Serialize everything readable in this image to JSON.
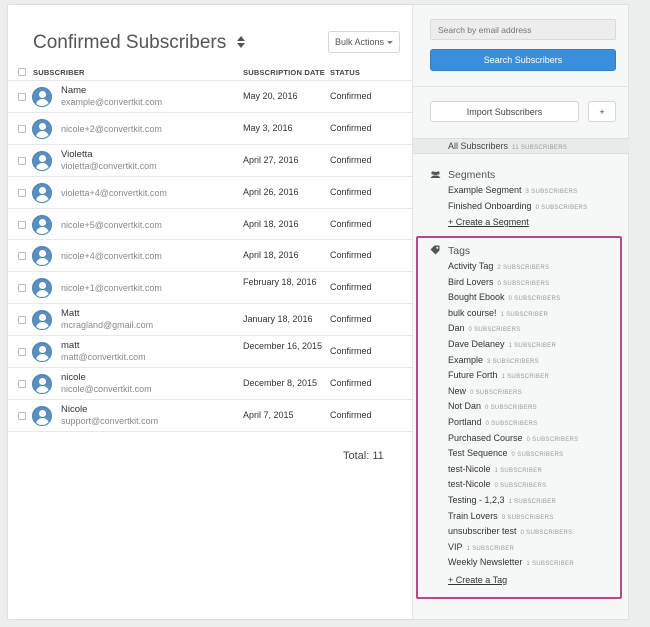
{
  "main": {
    "title": "Confirmed Subscribers",
    "bulk_actions_label": "Bulk Actions",
    "columns": {
      "subscriber": "SUBSCRIBER",
      "date": "SUBSCRIPTION DATE",
      "status": "STATUS"
    },
    "rows": [
      {
        "name": "Name",
        "email": "example@convertkit.com",
        "date": "May 20, 2016",
        "status": "Confirmed"
      },
      {
        "name": "",
        "email": "nicole+2@convertkit.com",
        "date": "May 3, 2016",
        "status": "Confirmed"
      },
      {
        "name": "Violetta",
        "email": "violetta@convertkit.com",
        "date": "April 27, 2016",
        "status": "Confirmed"
      },
      {
        "name": "",
        "email": "violetta+4@convertkit.com",
        "date": "April 26, 2016",
        "status": "Confirmed"
      },
      {
        "name": "",
        "email": "nicole+5@convertkit.com",
        "date": "April 18, 2016",
        "status": "Confirmed"
      },
      {
        "name": "",
        "email": "nicole+4@convertkit.com",
        "date": "April 18, 2016",
        "status": "Confirmed"
      },
      {
        "name": "",
        "email": "nicole+1@convertkit.com",
        "date": "February 18, 2016",
        "status": "Confirmed"
      },
      {
        "name": "Matt",
        "email": "mcragland@gmail.com",
        "date": "January 18, 2016",
        "status": "Confirmed"
      },
      {
        "name": "matt",
        "email": "matt@convertkit.com",
        "date": "December 16, 2015",
        "status": "Confirmed"
      },
      {
        "name": "nicole",
        "email": "nicole@convertkit.com",
        "date": "December 8, 2015",
        "status": "Confirmed"
      },
      {
        "name": "Nicole",
        "email": "support@convertkit.com",
        "date": "April 7, 2015",
        "status": "Confirmed"
      }
    ],
    "total": "Total: 11"
  },
  "sidebar": {
    "search_placeholder": "Search by email address",
    "search_button": "Search Subscribers",
    "import_button": "Import Subscribers",
    "add_button": "+",
    "all_subscribers": {
      "label": "All Subscribers",
      "count": "11 SUBSCRIBERS"
    },
    "segments": {
      "title": "Segments",
      "items": [
        {
          "label": "Example Segment",
          "count": "3 SUBSCRIBERS"
        },
        {
          "label": "Finished Onboarding",
          "count": "0 SUBSCRIBERS"
        }
      ],
      "create_link": "+ Create a Segment"
    },
    "tags": {
      "title": "Tags",
      "items": [
        {
          "label": "Activity Tag",
          "count": "2 SUBSCRIBERS"
        },
        {
          "label": "Bird Lovers",
          "count": "0 SUBSCRIBERS"
        },
        {
          "label": "Bought Ebook",
          "count": "0 SUBSCRIBERS"
        },
        {
          "label": "bulk course!",
          "count": "1 SUBSCRIBER"
        },
        {
          "label": "Dan",
          "count": "0 SUBSCRIBERS"
        },
        {
          "label": "Dave Delaney",
          "count": "1 SUBSCRIBER"
        },
        {
          "label": "Example",
          "count": "3 SUBSCRIBERS"
        },
        {
          "label": "Future Forth",
          "count": "1 SUBSCRIBER"
        },
        {
          "label": "New",
          "count": "0 SUBSCRIBERS"
        },
        {
          "label": "Not Dan",
          "count": "0 SUBSCRIBERS"
        },
        {
          "label": "Portland",
          "count": "0 SUBSCRIBERS"
        },
        {
          "label": "Purchased Course",
          "count": "0 SUBSCRIBERS"
        },
        {
          "label": "Test Sequence",
          "count": "0 SUBSCRIBERS"
        },
        {
          "label": "test-Nicole",
          "count": "1 SUBSCRIBER"
        },
        {
          "label": "test-Nicole",
          "count": "0 SUBSCRIBERS"
        },
        {
          "label": "Testing - 1,2,3",
          "count": "1 SUBSCRIBER"
        },
        {
          "label": "Train Lovers",
          "count": "0 SUBSCRIBERS"
        },
        {
          "label": "unsubscriber test",
          "count": "0 SUBSCRIBERS"
        },
        {
          "label": "VIP",
          "count": "1 SUBSCRIBER"
        },
        {
          "label": "Weekly Newsletter",
          "count": "1 SUBSCRIBER"
        }
      ],
      "create_link": "+ Create a Tag"
    }
  },
  "colors": {
    "accent": "#3a8fdc",
    "highlight_border": "#b54b8a",
    "avatar": "#5a8fc2"
  },
  "icons": {
    "sort": "sort-up-down-icon",
    "caret": "caret-down-icon",
    "avatar": "user-avatar-icon",
    "segments": "people-group-icon",
    "tags": "tag-icon"
  }
}
